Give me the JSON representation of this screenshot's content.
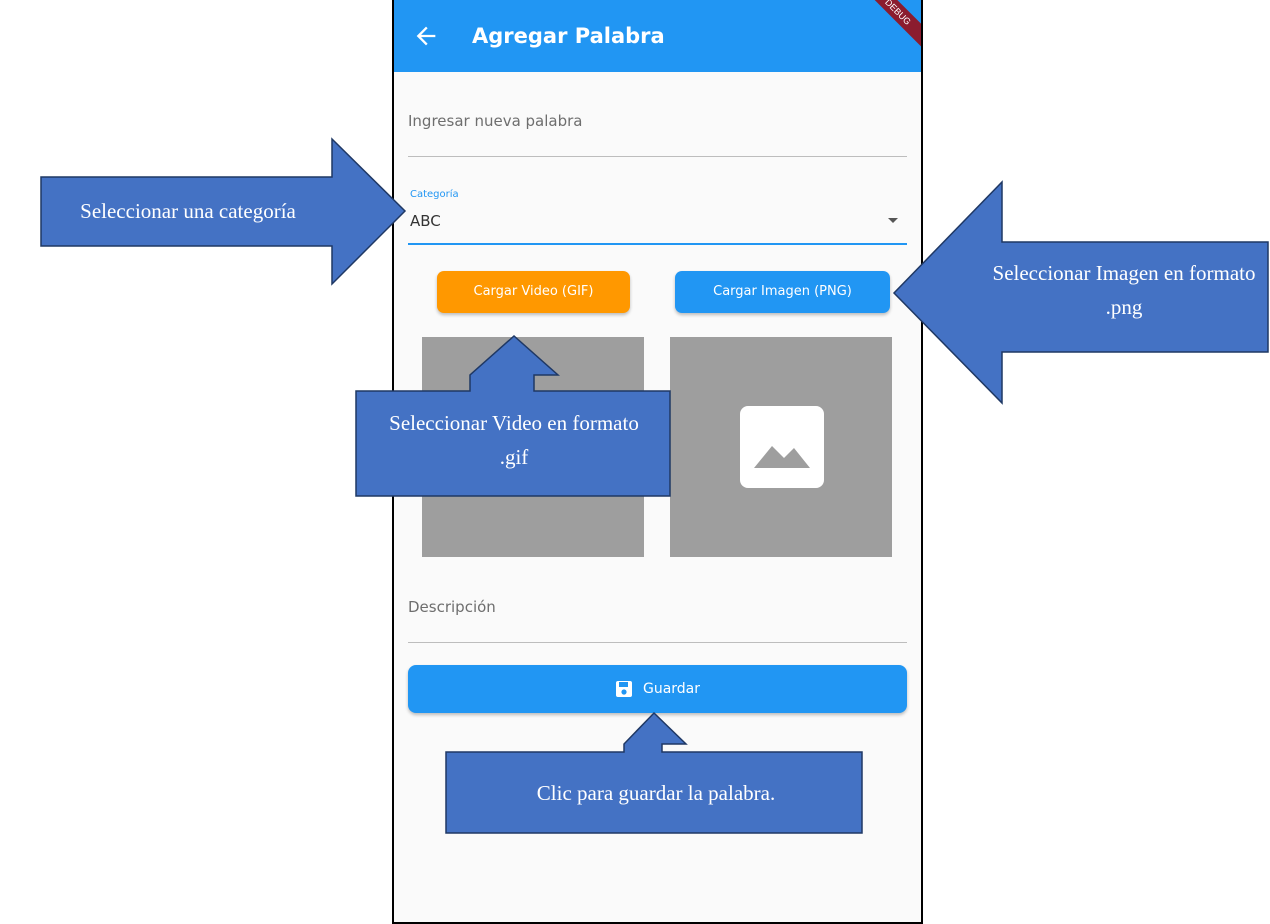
{
  "app": {
    "title": "Agregar Palabra",
    "debug_banner": "DEBUG"
  },
  "form": {
    "word_placeholder": "Ingresar nueva palabra",
    "category_label": "Categoría",
    "category_value": "ABC",
    "video_button": "Cargar Video (GIF)",
    "image_button": "Cargar Imagen (PNG)",
    "description_placeholder": "Descripción",
    "save_button": "Guardar"
  },
  "annotations": {
    "category": "Seleccionar una categoría",
    "image": "Seleccionar Imagen en formato .png",
    "video": "Seleccionar Video en formato .gif",
    "save": "Clic para guardar la palabra."
  },
  "colors": {
    "primary": "#2196f3",
    "accent_orange": "#ff9800",
    "callout_fill": "#4472c4",
    "preview_gray": "#9e9e9e"
  },
  "icons": {
    "back": "arrow-left-icon",
    "image_placeholder": "image-icon",
    "save": "floppy-disk-icon",
    "dropdown": "caret-down-icon"
  }
}
